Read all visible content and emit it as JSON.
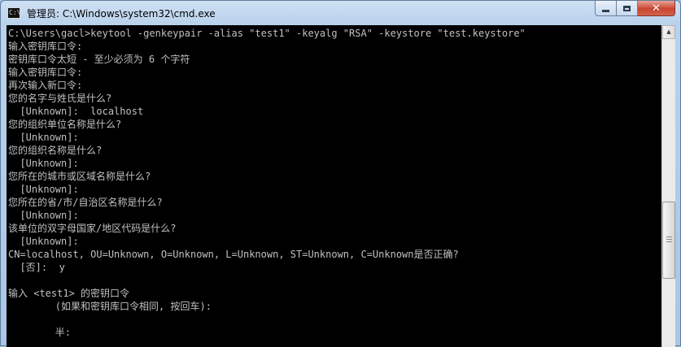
{
  "window": {
    "title": "管理员: C:\\Windows\\system32\\cmd.exe",
    "icon_text": "C:\\"
  },
  "controls": {
    "minimize": "minimize-icon",
    "maximize": "maximize-icon",
    "close": "✕"
  },
  "console": {
    "lines": [
      "C:\\Users\\gacl>keytool -genkeypair -alias \"test1\" -keyalg \"RSA\" -keystore \"test.keystore\"",
      "输入密钥库口令:",
      "密钥库口令太短 - 至少必须为 6 个字符",
      "输入密钥库口令:",
      "再次输入新口令:",
      "您的名字与姓氏是什么?",
      "  [Unknown]:  localhost",
      "您的组织单位名称是什么?",
      "  [Unknown]:",
      "您的组织名称是什么?",
      "  [Unknown]:",
      "您所在的城市或区域名称是什么?",
      "  [Unknown]:",
      "您所在的省/市/自治区名称是什么?",
      "  [Unknown]:",
      "该单位的双字母国家/地区代码是什么?",
      "  [Unknown]:",
      "CN=localhost, OU=Unknown, O=Unknown, L=Unknown, ST=Unknown, C=Unknown是否正确?",
      "  [否]:  y",
      "",
      "输入 <test1> 的密钥口令",
      "        (如果和密钥库口令相同, 按回车):",
      "",
      "        半:"
    ]
  },
  "scrollbar": {
    "up_arrow": "▲",
    "scroll_position": 0.56
  }
}
